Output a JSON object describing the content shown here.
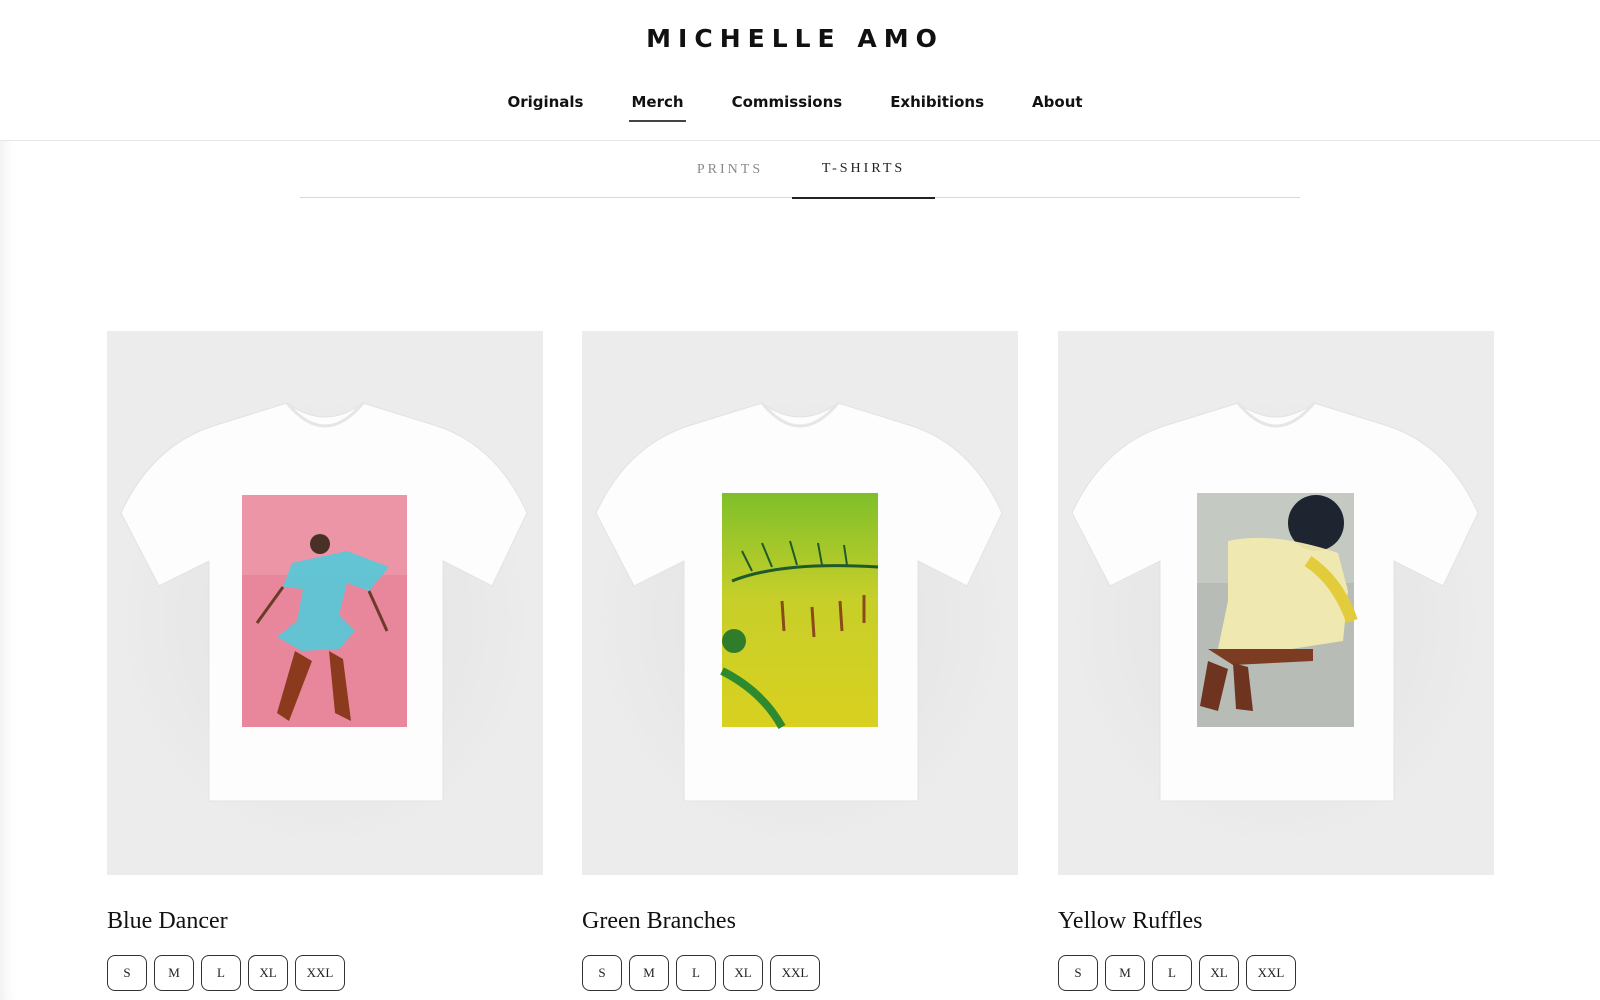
{
  "brand": "MICHELLE AMO",
  "nav": [
    "Originals",
    "Merch",
    "Commissions",
    "Exhibitions",
    "About"
  ],
  "nav_active": "Merch",
  "subtabs": {
    "prints": "PRINTS",
    "tshirts": "T-SHIRTS",
    "active": "T-SHIRTS"
  },
  "products": [
    {
      "title": "Blue Dancer",
      "sizes": [
        "S",
        "M",
        "L",
        "XL",
        "XXL"
      ]
    },
    {
      "title": "Green Branches",
      "sizes": [
        "S",
        "M",
        "L",
        "XL",
        "XXL"
      ]
    },
    {
      "title": "Yellow Ruffles",
      "sizes": [
        "S",
        "M",
        "L",
        "XL",
        "XXL"
      ]
    }
  ],
  "colors": {
    "card_bg": "#ececec",
    "shirt": "#ffffff",
    "text": "#111111"
  }
}
